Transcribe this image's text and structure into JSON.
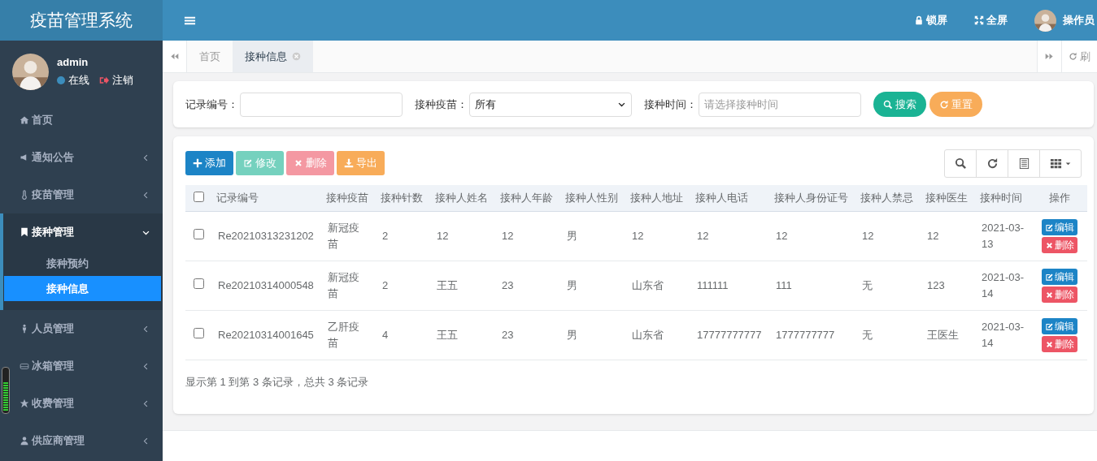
{
  "sidebar": {
    "logo": "疫苗管理系统",
    "user": {
      "name": "admin",
      "status": "在线",
      "logout": "注销"
    },
    "items": [
      {
        "label": "首页",
        "kind": "link",
        "expanded": false
      },
      {
        "label": "通知公告",
        "kind": "menu",
        "expanded": false
      },
      {
        "label": "疫苗管理",
        "kind": "menu",
        "expanded": false
      },
      {
        "label": "接种管理",
        "kind": "menu",
        "expanded": true,
        "children": [
          {
            "label": "接种预约",
            "selected": false
          },
          {
            "label": "接种信息",
            "selected": true
          }
        ]
      },
      {
        "label": "人员管理",
        "kind": "menu",
        "expanded": false
      },
      {
        "label": "冰箱管理",
        "kind": "menu",
        "expanded": false
      },
      {
        "label": "收费管理",
        "kind": "menu",
        "expanded": false
      },
      {
        "label": "供应商管理",
        "kind": "menu",
        "expanded": false
      }
    ]
  },
  "topbar": {
    "actions": [
      {
        "label": "锁屏",
        "kind": "lock"
      },
      {
        "label": "全屏",
        "kind": "fullscreen"
      }
    ],
    "user": "操作员"
  },
  "tabs": [
    {
      "label": "首页",
      "selected": false,
      "closable": false
    },
    {
      "label": "接种信息",
      "selected": true,
      "closable": true
    }
  ],
  "refresh": "刷",
  "search": {
    "fields": [
      {
        "kind": "text",
        "label": "记录编号："
      },
      {
        "kind": "select",
        "label": "接种疫苗：",
        "value": "所有"
      },
      {
        "kind": "date",
        "label": "接种时间：",
        "placeholder": "请选择接种时间"
      }
    ],
    "buttons": [
      {
        "label": "搜索",
        "kind": "search"
      },
      {
        "label": "重置",
        "kind": "reset"
      }
    ]
  },
  "toolbar": [
    {
      "label": "添加",
      "kind": "add",
      "disabled": false
    },
    {
      "label": "修改",
      "kind": "edit",
      "disabled": true
    },
    {
      "label": "删除",
      "kind": "delete",
      "disabled": true
    },
    {
      "label": "导出",
      "kind": "export",
      "disabled": false
    }
  ],
  "table": {
    "all_checked": false,
    "columns": [
      "记录编号",
      "接种疫苗",
      "接种针数",
      "接种人姓名",
      "接种人年龄",
      "接种人性别",
      "接种人地址",
      "接种人电话",
      "接种人身份证号",
      "接种人禁忌",
      "接种医生",
      "接种时间",
      "操作"
    ],
    "rows": [
      {
        "checked": false,
        "cells": [
          "Re20210313231202",
          "新冠疫苗",
          "2",
          "12",
          "12",
          "男",
          "12",
          "12",
          "12",
          "12",
          "12",
          "2021-03-13"
        ],
        "actions": [
          {
            "label": "编辑",
            "kind": "edit"
          },
          {
            "label": "删除",
            "kind": "delete"
          }
        ]
      },
      {
        "checked": false,
        "cells": [
          "Re20210314000548",
          "新冠疫苗",
          "2",
          "王五",
          "23",
          "男",
          "山东省",
          "111111",
          "111",
          "无",
          "123",
          "2021-03-14"
        ],
        "actions": [
          {
            "label": "编辑",
            "kind": "edit"
          },
          {
            "label": "删除",
            "kind": "delete"
          }
        ]
      },
      {
        "checked": false,
        "cells": [
          "Re20210314001645",
          "乙肝疫苗",
          "4",
          "王五",
          "23",
          "男",
          "山东省",
          "17777777777",
          "1777777777",
          "无",
          "王医生",
          "2021-03-14"
        ],
        "actions": [
          {
            "label": "编辑",
            "kind": "edit"
          },
          {
            "label": "删除",
            "kind": "delete"
          }
        ]
      }
    ]
  },
  "pagination_info": "显示第 1 到第 3 条记录，总共 3 条记录"
}
